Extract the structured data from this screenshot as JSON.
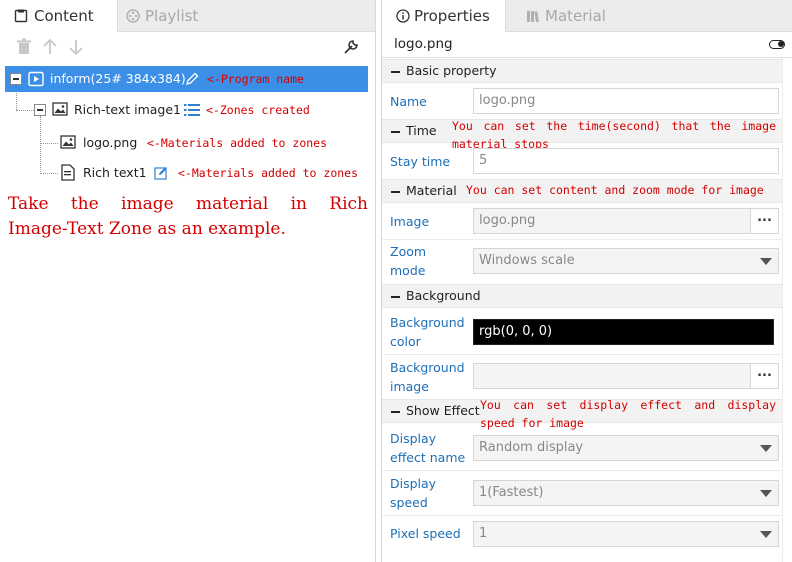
{
  "left_panel": {
    "tabs": [
      {
        "label": "Content",
        "active": true,
        "icon": "book-icon"
      },
      {
        "label": "Playlist",
        "active": false,
        "icon": "film-reel-icon"
      }
    ],
    "toolbar": [
      "trash-icon",
      "arrow-up-icon",
      "arrow-down-icon",
      "wrench-icon"
    ],
    "tree": {
      "program": {
        "label": "inform(25# 384x384)",
        "icon": "play-box-icon",
        "edit_icon": "pencil-icon",
        "annotation": "<-Program name"
      },
      "zone": {
        "label": "Rich-text image1",
        "icon": "image-icon",
        "list_icon": "list-icon",
        "annotation": "<-Zones created"
      },
      "materials": [
        {
          "label": "logo.png",
          "icon": "image-icon",
          "annotation": "<-Materials added to zones"
        },
        {
          "label": "Rich text1",
          "icon": "document-icon",
          "edit_icon": "edit-square-icon",
          "annotation": "<-Materials added to zones"
        }
      ]
    },
    "note_lines": [
      "Take the image material in Rich",
      "Image-Text Zone as an example."
    ]
  },
  "right_panel": {
    "tabs": [
      {
        "label": "Properties",
        "active": true,
        "icon": "info-icon"
      },
      {
        "label": "Material",
        "active": false,
        "icon": "library-icon"
      }
    ],
    "header_title": "logo.png",
    "sections": {
      "basic": {
        "title": "Basic property",
        "name_label": "Name",
        "name_value": "logo.png"
      },
      "time": {
        "title": "Time",
        "annotation": "You can set the time(second) that the image material stops",
        "stay_label": "Stay time",
        "stay_value": "5"
      },
      "material": {
        "title": "Material",
        "annotation": "You can set content and zoom mode for image",
        "image_label": "Image",
        "image_value": "logo.png",
        "browse_label": "...",
        "zoom_label": "Zoom mode",
        "zoom_value": "Windows scale"
      },
      "background": {
        "title": "Background",
        "color_label": "Background color",
        "color_value": "rgb(0, 0, 0)",
        "image_label": "Background image",
        "image_value": "",
        "browse_label": "..."
      },
      "effect": {
        "title": "Show Effect",
        "annotation": "You can set display effect and display speed for image",
        "effect_label": "Display effect name",
        "effect_value": "Random display",
        "speed_label": "Display speed",
        "speed_value": "1(Fastest)",
        "pixel_label": "Pixel speed",
        "pixel_value": "1"
      }
    }
  },
  "colors": {
    "selection": "#3c8fe6",
    "annotation": "#d40000",
    "field_label": "#1e6fb8",
    "section_bg": "#f2f2f2"
  }
}
